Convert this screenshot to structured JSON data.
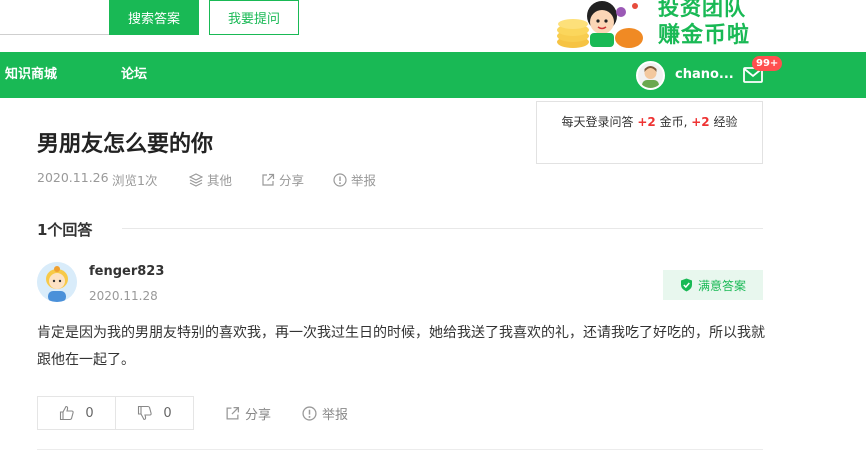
{
  "header": {
    "search_button": "搜索答案",
    "ask_button": "我要提问",
    "promo_line1": "投资团队",
    "promo_line2": "赚金币啦"
  },
  "nav": {
    "items": [
      "知识商城",
      "论坛"
    ],
    "username": "chano...",
    "message_badge": "99+"
  },
  "tooltip": {
    "prefix": "每天登录问答",
    "coin_plus": "+2",
    "coin_text": "金币,",
    "exp_plus": "+2",
    "exp_text": "经验"
  },
  "question": {
    "title": "男朋友怎么要的你",
    "date": "2020.11.26",
    "views": "浏览1次",
    "category": "其他",
    "share": "分享",
    "report": "举报"
  },
  "answers": {
    "count_label": "1个回答",
    "items": [
      {
        "username": "fenger823",
        "date": "2020.11.28",
        "best_label": "满意答案",
        "text": "  肯定是因为我的男朋友特别的喜欢我，再一次我过生日的时候，她给我送了我喜欢的礼，还请我吃了好吃的，所以我就跟他在一起了。",
        "likes": "0",
        "dislikes": "0",
        "share": "分享",
        "report": "举报"
      }
    ]
  },
  "colors": {
    "brand": "#19b955",
    "badge": "#ff4f4f",
    "highlight": "#e33"
  },
  "icons": [
    "layers-icon",
    "share-icon",
    "report-icon",
    "mail-icon",
    "shield-check-icon",
    "thumb-up-icon",
    "thumb-down-icon"
  ]
}
